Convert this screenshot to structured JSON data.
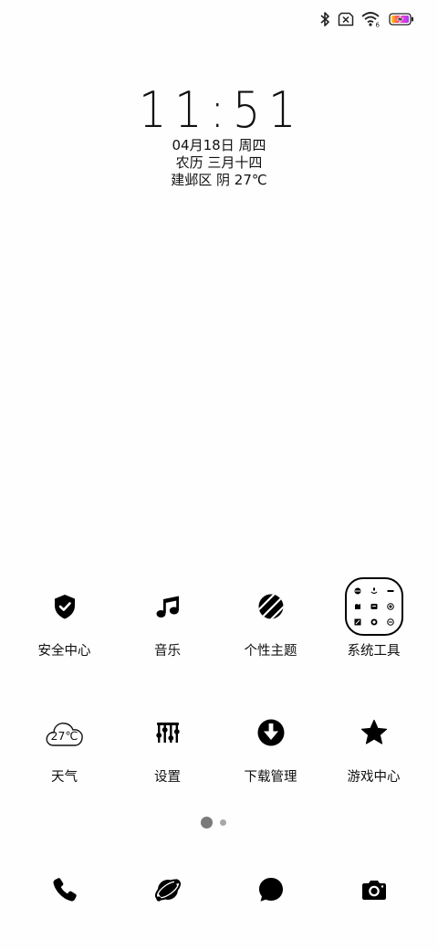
{
  "status_bar": {
    "icons": [
      "bluetooth-icon",
      "no-sim-icon",
      "wifi-icon",
      "battery-charging-icon"
    ],
    "wifi_badge": "6"
  },
  "clock": {
    "time": "11:51",
    "date": "04月18日 周四",
    "lunar": "农历 三月十四",
    "weather": "建邺区 阴 27℃"
  },
  "apps": {
    "row1": [
      {
        "label": "安全中心",
        "icon": "shield-check-icon"
      },
      {
        "label": "音乐",
        "icon": "music-note-icon"
      },
      {
        "label": "个性主题",
        "icon": "theme-ball-icon"
      },
      {
        "label": "系统工具",
        "icon": "system-tools-folder-icon"
      }
    ],
    "row2": [
      {
        "label": "天气",
        "icon": "cloud-icon",
        "temp": "27℃"
      },
      {
        "label": "设置",
        "icon": "settings-sliders-icon"
      },
      {
        "label": "下载管理",
        "icon": "download-icon"
      },
      {
        "label": "游戏中心",
        "icon": "star-icon"
      }
    ]
  },
  "page_indicator": {
    "pages": 2,
    "current": 1
  },
  "dock": [
    {
      "icon": "phone-icon"
    },
    {
      "icon": "browser-planet-icon"
    },
    {
      "icon": "messages-icon"
    },
    {
      "icon": "camera-icon"
    }
  ]
}
